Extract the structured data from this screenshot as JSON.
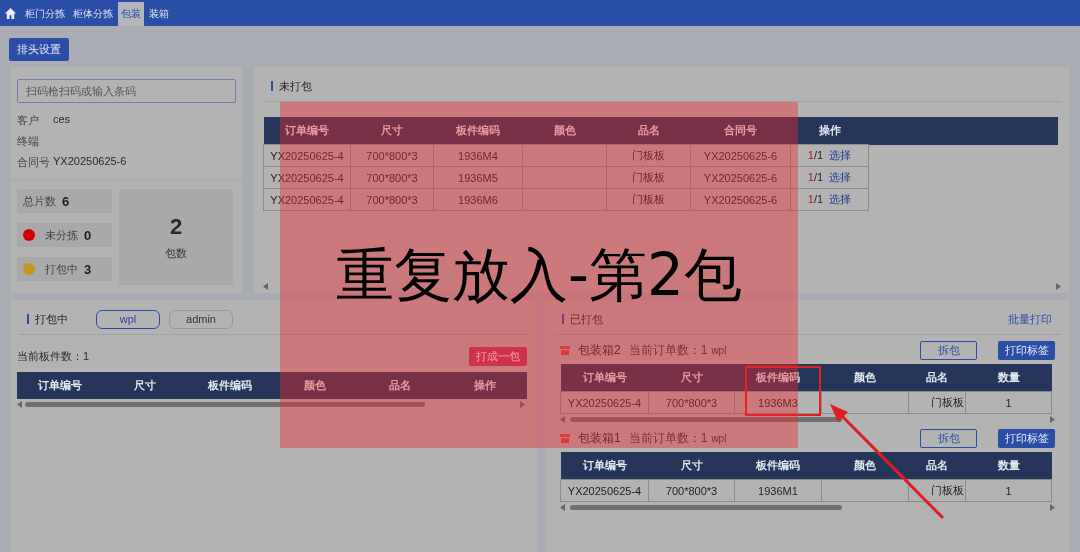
{
  "nav": {
    "tabs": [
      {
        "label": "柜门分拣",
        "selected": false
      },
      {
        "label": "柜体分拣",
        "selected": false
      },
      {
        "label": "包装",
        "selected": true
      },
      {
        "label": "装箱",
        "selected": false
      }
    ]
  },
  "toolbar": {
    "button": "排头设置"
  },
  "scan": {
    "placeholder": "扫码枪扫码或输入条码",
    "info": [
      {
        "label": "客户",
        "value": "ces"
      },
      {
        "label": "终端"
      },
      {
        "label": "合同号",
        "value": "YX20250625-6"
      }
    ]
  },
  "stats": {
    "items": [
      {
        "label": "总片数",
        "value": "6"
      },
      {
        "label": "未分拣",
        "value": "0",
        "color": "#d40000"
      },
      {
        "label": "打包中",
        "value": "3",
        "color": "#c8961e"
      }
    ],
    "total": {
      "value": "2",
      "label": "包数"
    }
  },
  "unpacked": {
    "title": "未打包",
    "columns": [
      "订单编号",
      "尺寸",
      "板件编码",
      "颜色",
      "品名",
      "合同号",
      "操作"
    ],
    "rows": [
      {
        "order_no": "YX20250625-4",
        "size": "700*800*3",
        "panel_code": "1936M4",
        "product": "门板板",
        "contract_no": "YX20250625-6",
        "done": "1",
        "total": "/1",
        "action": "选择"
      },
      {
        "order_no": "YX20250625-4",
        "size": "700*800*3",
        "panel_code": "1936M5",
        "product": "门板板",
        "contract_no": "YX20250625-6",
        "done": "1",
        "total": "/1",
        "action": "选择"
      },
      {
        "order_no": "YX20250625-4",
        "size": "700*800*3",
        "panel_code": "1936M6",
        "product": "门板板",
        "contract_no": "YX20250625-6",
        "done": "1",
        "total": "/1",
        "action": "选择"
      }
    ]
  },
  "packing": {
    "title": "打包中",
    "users": [
      {
        "label": "wpl",
        "selected": true
      },
      {
        "label": "admin",
        "selected": false
      }
    ],
    "count": "当前板件数：1",
    "button": "打成一包",
    "columns": [
      "订单编号",
      "尺寸",
      "板件编码",
      "颜色",
      "品名",
      "操作"
    ]
  },
  "packed": {
    "title": "已打包",
    "link": "批量打印",
    "boxes": [
      {
        "name": "包装箱2",
        "orders": "当前订单数：1",
        "user": "wpl",
        "buttons": [
          "拆包",
          "打印标签"
        ],
        "columns": [
          "订单编号",
          "尺寸",
          "板件编码",
          "颜色",
          "品名",
          "数量"
        ],
        "rows": [
          {
            "order_no": "YX20250625-4",
            "size": "700*800*3",
            "panel_code": "1936M3",
            "product": "门板板",
            "qty": "1",
            "highlighted": true
          }
        ]
      },
      {
        "name": "包装箱1",
        "orders": "当前订单数：1",
        "user": "wpl",
        "buttons": [
          "拆包",
          "打印标签"
        ],
        "columns": [
          "订单编号",
          "尺寸",
          "板件编码",
          "颜色",
          "品名",
          "数量"
        ],
        "rows": [
          {
            "order_no": "YX20250625-4",
            "size": "700*800*3",
            "panel_code": "1936M1",
            "product": "门板板",
            "qty": "1",
            "highlighted": false
          }
        ]
      }
    ]
  },
  "alert": {
    "message": "重复放入-第2包"
  }
}
